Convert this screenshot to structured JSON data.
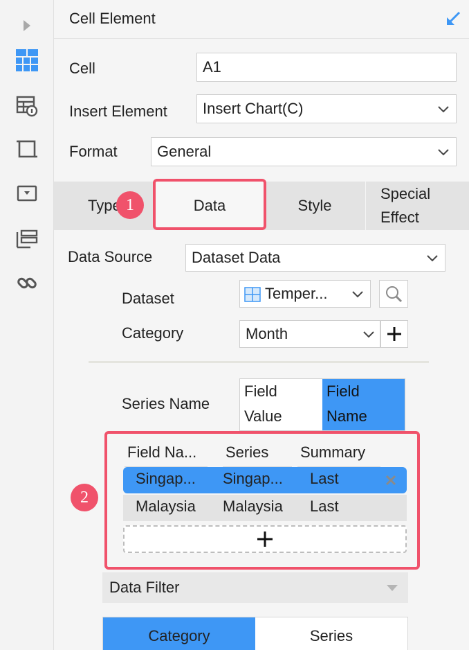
{
  "sidebar": {
    "icons": [
      "expand-arrow-icon",
      "cell-element-icon",
      "cell-attribute-icon",
      "float-element-icon",
      "widget-settings-icon",
      "template-settings-icon",
      "hyperlink-icon"
    ]
  },
  "header": {
    "title": "Cell Element"
  },
  "form": {
    "cell_label": "Cell",
    "cell_value": "A1",
    "insert_label": "Insert Element",
    "insert_value": "Insert Chart(C)",
    "format_label": "Format",
    "format_value": "General"
  },
  "tabs": {
    "type": "Type",
    "data": "Data",
    "style": "Style",
    "special_line1": "Special",
    "special_line2": "Effect"
  },
  "badges": {
    "one": "1",
    "two": "2"
  },
  "data_source": {
    "label": "Data Source",
    "value": "Dataset Data"
  },
  "dataset": {
    "label": "Dataset",
    "value": "Temper..."
  },
  "category": {
    "label": "Category",
    "value": "Month"
  },
  "series_name": {
    "label": "Series Name",
    "option1_line1": "Field",
    "option1_line2": "Value",
    "option2_line1": "Field",
    "option2_line2": "Name",
    "selected": "Field Name"
  },
  "series_table": {
    "headers": [
      "Field Na...",
      "Series",
      "Summary"
    ],
    "rows": [
      {
        "field": "Singap...",
        "series": "Singap...",
        "summary": "Last"
      },
      {
        "field": "Malaysia",
        "series": "Malaysia",
        "summary": "Last"
      }
    ]
  },
  "data_filter": {
    "label": "Data Filter"
  },
  "filter_tabs": {
    "category": "Category",
    "series": "Series"
  },
  "colors": {
    "accent": "#3e97f5",
    "highlight": "#f0526b"
  }
}
